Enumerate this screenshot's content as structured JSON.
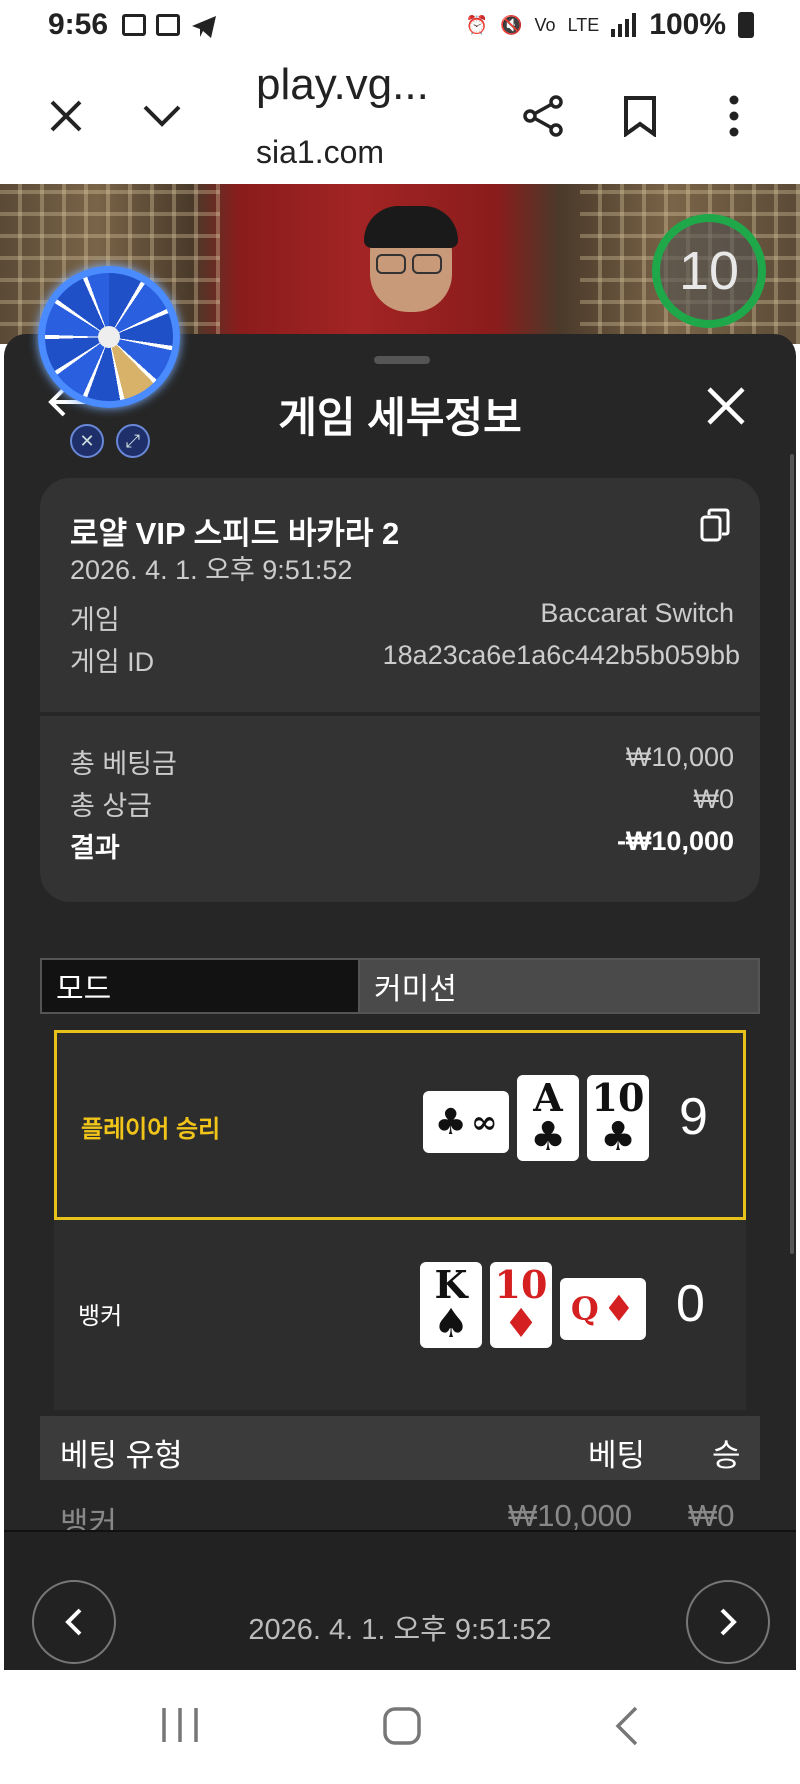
{
  "status_bar": {
    "time": "9:56",
    "battery": "100%"
  },
  "browser": {
    "url_line1": "play.vg...",
    "url_line2": "sia1.com"
  },
  "video": {
    "timer_value": "10"
  },
  "panel": {
    "title": "게임 세부정보",
    "summary": {
      "game_name": "로얄 VIP 스피드 바카라 2",
      "datetime": "2026. 4. 1. 오후 9:51:52",
      "game_label": "게임",
      "game_value": "Baccarat Switch",
      "game_id_label": "게임 ID",
      "game_id_value": "18a23ca6e1a6c442b5b059bb"
    },
    "totals": {
      "total_bet_label": "총 베팅금",
      "total_bet_value": "₩10,000",
      "total_win_label": "총 상금",
      "total_win_value": "₩0",
      "result_label": "결과",
      "result_value": "-₩10,000"
    },
    "mode_bar": {
      "mode_label": "모드",
      "mode_value": "커미션"
    },
    "player_hand": {
      "label": "플레이어 승리",
      "score": "9",
      "cards": [
        {
          "rank": "∞",
          "suit": "♣",
          "color": "black",
          "sideways": true
        },
        {
          "rank": "A",
          "suit": "♣",
          "color": "black",
          "sideways": false
        },
        {
          "rank": "10",
          "suit": "♣",
          "color": "black",
          "sideways": false
        }
      ]
    },
    "banker_hand": {
      "label": "뱅커",
      "score": "0",
      "cards": [
        {
          "rank": "K",
          "suit": "♠",
          "color": "black",
          "sideways": false
        },
        {
          "rank": "10",
          "suit": "♦",
          "color": "red",
          "sideways": false
        },
        {
          "rank": "Q",
          "suit": "♦",
          "color": "red",
          "sideways": true
        }
      ]
    },
    "bet_table": {
      "headers": {
        "type": "베팅 유형",
        "bet": "베팅",
        "win": "승"
      },
      "rows": [
        {
          "type": "뱅커",
          "bet": "₩10,000",
          "win": "₩0"
        }
      ]
    },
    "footer": {
      "datetime": "2026. 4. 1. 오후 9:51:52"
    }
  },
  "colors": {
    "win_highlight": "#e6c21a",
    "panel_bg": "#262626",
    "timer_ring": "#1fa84a"
  }
}
